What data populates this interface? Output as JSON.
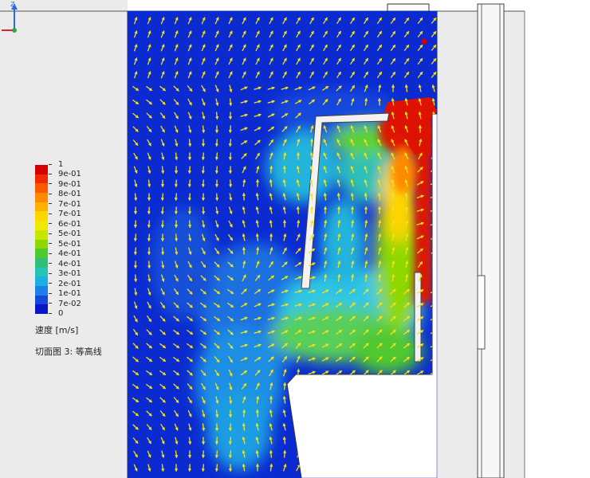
{
  "legend": {
    "title": "速度 [m/s]",
    "subtitle": "切面图 3: 等高线",
    "ticks": [
      "1",
      "9e-01",
      "9e-01",
      "8e-01",
      "7e-01",
      "7e-01",
      "6e-01",
      "5e-01",
      "5e-01",
      "4e-01",
      "4e-01",
      "3e-01",
      "2e-01",
      "1e-01",
      "7e-02",
      "0"
    ],
    "colors": [
      "#d50000",
      "#ee2a00",
      "#ff5a00",
      "#ff8a00",
      "#ffb000",
      "#ffd500",
      "#f0e800",
      "#c4e600",
      "#8ed800",
      "#4fc832",
      "#2fc078",
      "#23c4b4",
      "#1faee0",
      "#1c80e8",
      "#1746dc",
      "#0a14c8"
    ]
  },
  "colors": {
    "field_low": "#0b2bd0",
    "field_mid": "#2ec6e6",
    "field_green": "#5fd230",
    "field_high": "#e01800",
    "arrow": "#f4e21a",
    "solid": "#ebebeb"
  },
  "axis_triad": {
    "label": "Z"
  }
}
